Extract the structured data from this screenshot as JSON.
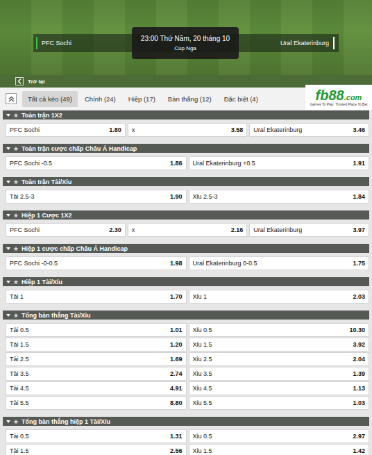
{
  "match": {
    "home": "PFC Sochi",
    "away": "Ural Ekaterinburg",
    "time": "23:00 Thứ Năm, 20 tháng 10",
    "competition": "Cúp Nga"
  },
  "back": {
    "label": "Trở lại"
  },
  "tabs": [
    {
      "label": "Tất cả kèo (49)",
      "selected": true
    },
    {
      "label": "Chính (24)",
      "selected": false
    },
    {
      "label": "Hiệp (17)",
      "selected": false
    },
    {
      "label": "Bàn thắng (12)",
      "selected": false
    },
    {
      "label": "Đặc biệt (4)",
      "selected": false
    }
  ],
  "logo": {
    "brand": "fb88",
    "domain": ".com",
    "tagline": "Games To Play  Trusted Place To Bet"
  },
  "markets": [
    {
      "title": "Toàn trận 1X2",
      "expanded": true,
      "rows": [
        [
          {
            "label": "PFC Sochi",
            "odds": "1.80"
          },
          {
            "label": "x",
            "odds": "3.58"
          },
          {
            "label": "Ural Ekaterinburg",
            "odds": "3.46"
          }
        ]
      ]
    },
    {
      "title": "Toàn trận cược chấp Châu Á Handicap",
      "expanded": true,
      "rows": [
        [
          {
            "label": "PFC Sochi -0.5",
            "odds": "1.86"
          },
          {
            "label": "Ural Ekaterinburg +0.5",
            "odds": "1.91"
          }
        ]
      ]
    },
    {
      "title": "Toàn trận Tài/Xỉu",
      "expanded": true,
      "rows": [
        [
          {
            "label": "Tài 2.5-3",
            "odds": "1.90"
          },
          {
            "label": "Xỉu 2.5-3",
            "odds": "1.84"
          }
        ]
      ]
    },
    {
      "title": "Hiệp 1 Cược 1X2",
      "expanded": true,
      "rows": [
        [
          {
            "label": "PFC Sochi",
            "odds": "2.30"
          },
          {
            "label": "x",
            "odds": "2.16"
          },
          {
            "label": "Ural Ekaterinburg",
            "odds": "3.97"
          }
        ]
      ]
    },
    {
      "title": "Hiệp 1 cược chấp Châu Á Handicap",
      "expanded": true,
      "rows": [
        [
          {
            "label": "PFC Sochi -0-0.5",
            "odds": "1.98"
          },
          {
            "label": "Ural Ekaterinburg 0-0.5",
            "odds": "1.75"
          }
        ]
      ]
    },
    {
      "title": "Hiệp 1 Tài/Xỉu",
      "expanded": true,
      "rows": [
        [
          {
            "label": "Tài 1",
            "odds": "1.70"
          },
          {
            "label": "Xỉu 1",
            "odds": "2.03"
          }
        ]
      ]
    },
    {
      "title": "Tổng bàn thắng Tài/Xỉu",
      "expanded": true,
      "rows": [
        [
          {
            "label": "Tài 0.5",
            "odds": "1.01"
          },
          {
            "label": "Xỉu 0.5",
            "odds": "10.30"
          }
        ],
        [
          {
            "label": "Tài 1.5",
            "odds": "1.20"
          },
          {
            "label": "Xỉu 1.5",
            "odds": "3.92"
          }
        ],
        [
          {
            "label": "Tài 2.5",
            "odds": "1.69"
          },
          {
            "label": "Xỉu 2.5",
            "odds": "2.04"
          }
        ],
        [
          {
            "label": "Tài 3.5",
            "odds": "2.74"
          },
          {
            "label": "Xỉu 3.5",
            "odds": "1.39"
          }
        ],
        [
          {
            "label": "Tài 4.5",
            "odds": "4.91"
          },
          {
            "label": "Xỉu 4.5",
            "odds": "1.13"
          }
        ],
        [
          {
            "label": "Tài 5.5",
            "odds": "8.80"
          },
          {
            "label": "Xỉu 5.5",
            "odds": "1.03"
          }
        ]
      ]
    },
    {
      "title": "Tổng bàn thắng hiệp 1 Tài/Xỉu",
      "expanded": true,
      "rows": [
        [
          {
            "label": "Tài 0.5",
            "odds": "1.31"
          },
          {
            "label": "Xỉu 0.5",
            "odds": "2.97"
          }
        ],
        [
          {
            "label": "Tài 1.5",
            "odds": "2.56"
          },
          {
            "label": "Xỉu 1.5",
            "odds": "1.42"
          }
        ]
      ]
    }
  ]
}
